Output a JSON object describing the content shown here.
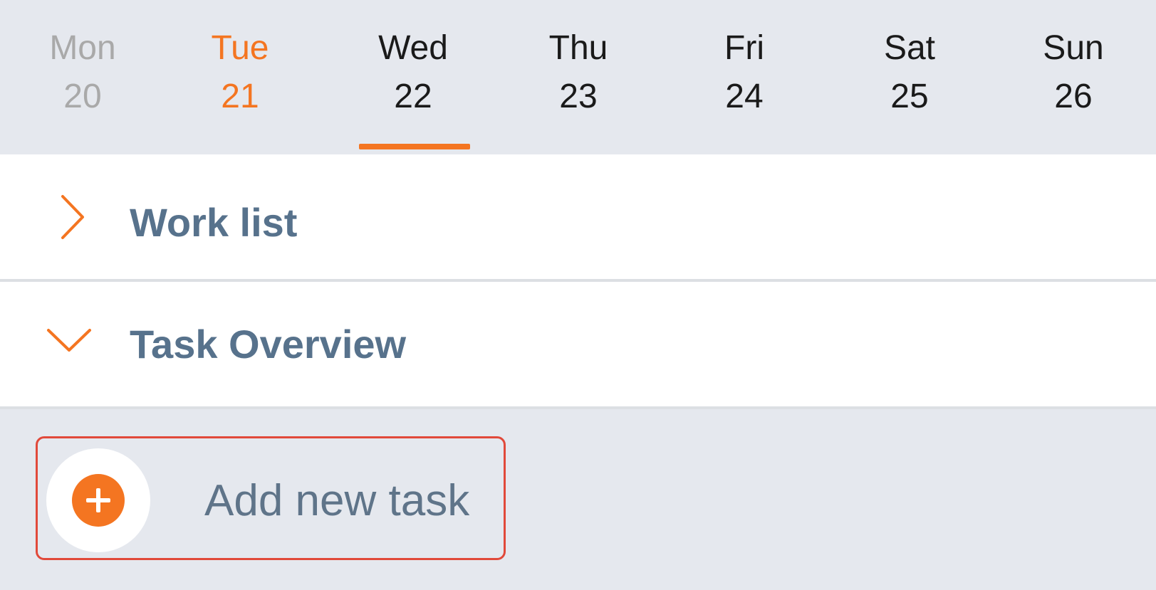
{
  "week": {
    "days": [
      {
        "name": "Mon",
        "num": "20",
        "state": "past"
      },
      {
        "name": "Tue",
        "num": "21",
        "state": "today"
      },
      {
        "name": "Wed",
        "num": "22",
        "state": "selected"
      },
      {
        "name": "Thu",
        "num": "23",
        "state": "future"
      },
      {
        "name": "Fri",
        "num": "24",
        "state": "future"
      },
      {
        "name": "Sat",
        "num": "25",
        "state": "future"
      },
      {
        "name": "Sun",
        "num": "26",
        "state": "future"
      }
    ]
  },
  "sections": {
    "work_list": {
      "title": "Work list",
      "expanded": false,
      "icon": "chevron-right-icon"
    },
    "task_overview": {
      "title": "Task Overview",
      "expanded": true,
      "icon": "chevron-down-icon"
    }
  },
  "add_task": {
    "label": "Add new task",
    "icon": "plus-circle-icon"
  },
  "colors": {
    "accent": "#f47521",
    "title": "#57728c",
    "background": "#e5e8ee",
    "highlight_border": "#e1493a"
  }
}
